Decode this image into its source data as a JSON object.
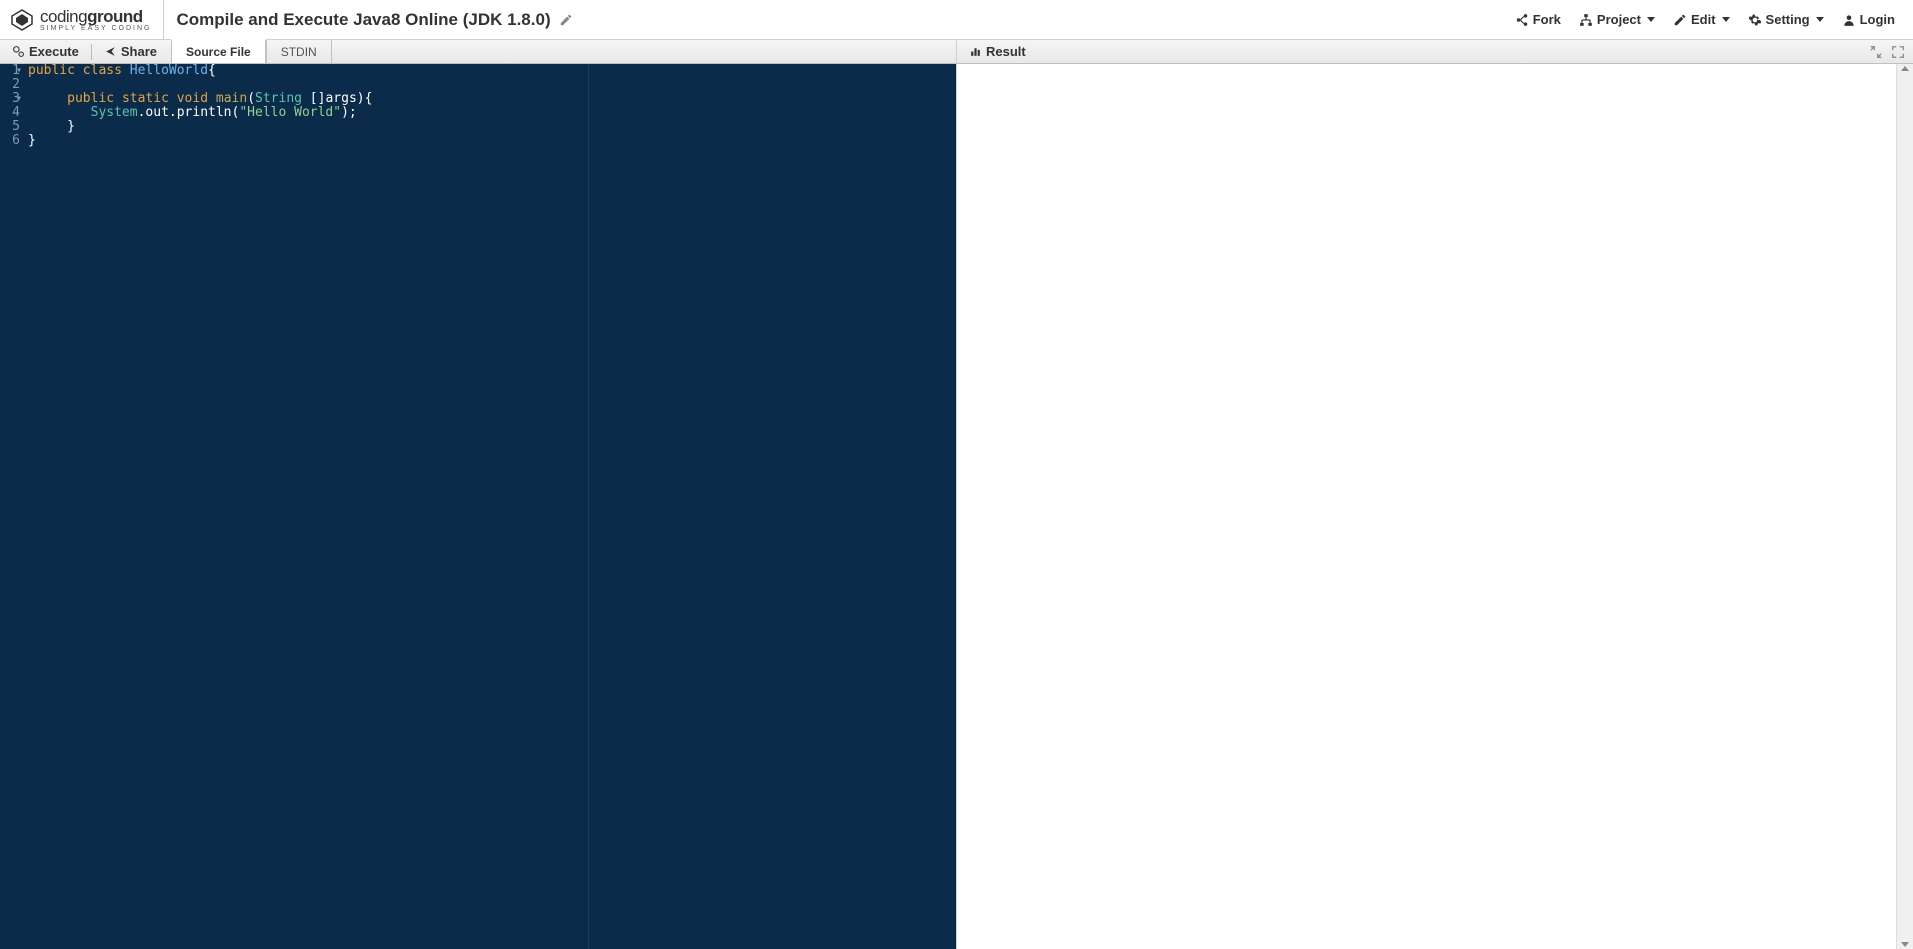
{
  "logo": {
    "brand_left": "coding",
    "brand_right": "ground",
    "tagline": "SIMPLY EASY CODING"
  },
  "page_title": "Compile and Execute Java8 Online (JDK 1.8.0)",
  "header_menu": {
    "fork": "Fork",
    "project": "Project",
    "edit": "Edit",
    "setting": "Setting",
    "login": "Login"
  },
  "left_toolbar": {
    "execute": "Execute",
    "share": "Share"
  },
  "tabs": {
    "source": "Source File",
    "stdin": "STDIN"
  },
  "right_toolbar": {
    "result": "Result"
  },
  "code": {
    "line_numbers": [
      "1",
      "2",
      "3",
      "4",
      "5",
      "6"
    ],
    "tokens": [
      [
        {
          "cls": "k-orange",
          "t": "public"
        },
        {
          "cls": "k-white",
          "t": " "
        },
        {
          "cls": "k-orange",
          "t": "class"
        },
        {
          "cls": "k-white",
          "t": " "
        },
        {
          "cls": "k-blue",
          "t": "HelloWorld"
        },
        {
          "cls": "k-white",
          "t": "{"
        }
      ],
      [],
      [
        {
          "cls": "k-white",
          "t": "     "
        },
        {
          "cls": "k-orange",
          "t": "public"
        },
        {
          "cls": "k-white",
          "t": " "
        },
        {
          "cls": "k-orange",
          "t": "static"
        },
        {
          "cls": "k-white",
          "t": " "
        },
        {
          "cls": "k-orange",
          "t": "void"
        },
        {
          "cls": "k-white",
          "t": " "
        },
        {
          "cls": "k-gold",
          "t": "main"
        },
        {
          "cls": "k-white",
          "t": "("
        },
        {
          "cls": "k-teal",
          "t": "String"
        },
        {
          "cls": "k-white",
          "t": " []args){"
        }
      ],
      [
        {
          "cls": "k-white",
          "t": "        "
        },
        {
          "cls": "k-teal",
          "t": "System"
        },
        {
          "cls": "k-white",
          "t": ".out.println("
        },
        {
          "cls": "k-green",
          "t": "\"Hello World\""
        },
        {
          "cls": "k-white",
          "t": ");"
        }
      ],
      [
        {
          "cls": "k-white",
          "t": "     }"
        }
      ],
      [
        {
          "cls": "k-white",
          "t": "}"
        }
      ]
    ],
    "fold_lines": [
      0,
      2
    ]
  }
}
